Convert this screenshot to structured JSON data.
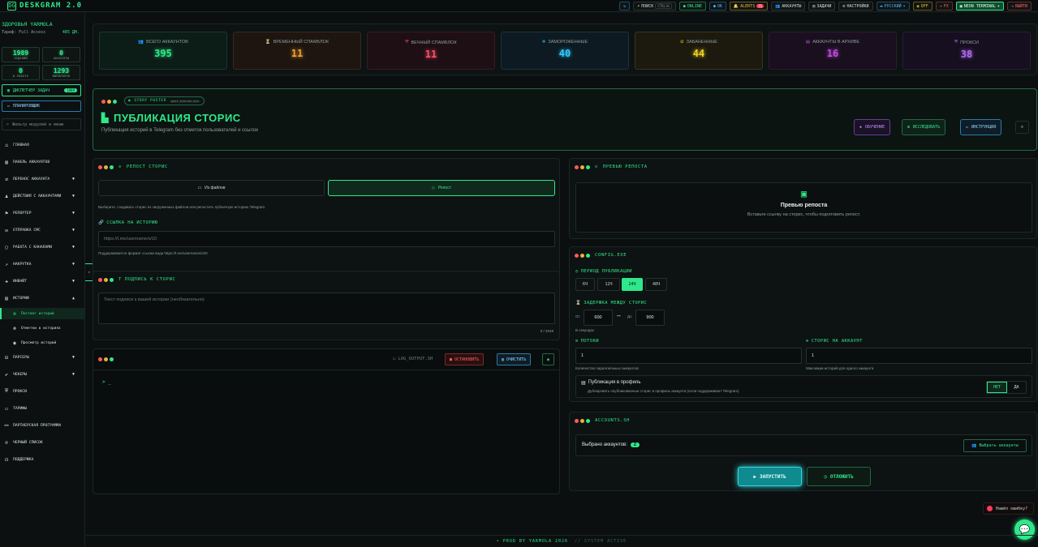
{
  "app": {
    "title": "DESKGRAM 2.0",
    "logo": "DG"
  },
  "topbar": {
    "refresh_icon": "refresh-icon",
    "search_label": "ПОИСК",
    "search_kbd": "CTRL+K",
    "online": "ONLINE",
    "ok": "OK",
    "alerts": "ALERTS",
    "alerts_count": "71",
    "accounts": "АККАУНТЫ",
    "tasks": "ЗАДАЧИ",
    "settings": "НАСТРОЙКИ",
    "language": "РУССКИЙ",
    "off": "OFF",
    "fx": "FX",
    "theme": "NEON TERMINAL",
    "logout": "ВЫЙТИ"
  },
  "sidebar": {
    "user_name": "ЗДОРОВЬЯ YARMOLA",
    "tariff": "Тариф: Full Access",
    "balance": "485 ДН.",
    "stats": [
      {
        "value": "1989",
        "label": "ЗАДАНИЙ"
      },
      {
        "value": "0",
        "label": "АККАУНТЫ"
      },
      {
        "value": "0",
        "label": "В РАБОТЕ"
      },
      {
        "value": "1293",
        "label": "ВЫПОЛНЕНО"
      }
    ],
    "dispatcher": "ДИСПЕТЧЕР ЗАДАЧ",
    "dispatcher_badge": "1989",
    "planner": "ПЛАНИРОВЩИК",
    "filter_placeholder": "Фильтр модулей и меню",
    "nav": [
      {
        "label": "ГЛАВНАЯ",
        "icon": "home-icon"
      },
      {
        "label": "ПАНЕЛЬ АККАУНТОВ",
        "icon": "users-icon"
      },
      {
        "label": "ПЕРЕНОС АККАУНТА",
        "icon": "transfer-icon",
        "chev": "▼"
      },
      {
        "label": "ДЕЙСТВИЯ С АККАУНТАМИ",
        "icon": "user-action-icon",
        "chev": "▼"
      },
      {
        "label": "РЕПОРТЕР",
        "icon": "flag-icon",
        "chev": "▼"
      },
      {
        "label": "ОТПРАВКА СМС",
        "icon": "message-icon",
        "chev": "▼"
      },
      {
        "label": "РАБОТА С КАНАЛАМИ",
        "icon": "channel-icon",
        "chev": "▼"
      },
      {
        "label": "НАКРУТКА",
        "icon": "chart-icon",
        "chev": "▼"
      },
      {
        "label": "ИНВАЙТ",
        "icon": "invite-icon",
        "chev": "▼"
      },
      {
        "label": "ИСТОРИИ",
        "icon": "stories-icon",
        "chev": "▲"
      }
    ],
    "sub_nav": [
      {
        "label": "Постинг историй",
        "icon": "plus-circle-icon"
      },
      {
        "label": "Отметки в историях",
        "icon": "tag-icon"
      },
      {
        "label": "Просмотр историй",
        "icon": "eye-icon"
      }
    ],
    "nav2": [
      {
        "label": "ПАРСЕРЫ",
        "icon": "parser-icon",
        "chev": "▼"
      },
      {
        "label": "ЧЕКЕРЫ",
        "icon": "check-icon",
        "chev": "▼"
      },
      {
        "label": "ПРОКСИ",
        "icon": "shield-icon"
      },
      {
        "label": "ТАРИФЫ",
        "icon": "card-icon"
      },
      {
        "label": "ПАРТНЕРСКАЯ ПРОГРАММА",
        "icon": "partner-icon"
      },
      {
        "label": "ЧЕРНЫЙ СПИСОК",
        "icon": "block-icon"
      },
      {
        "label": "ПОДДЕРЖКА",
        "icon": "support-icon"
      }
    ]
  },
  "stats_cards": [
    {
      "title": "ВСЕГО АККАУНТОВ",
      "value": "395",
      "color": "#2ee88a",
      "icon": "users-icon"
    },
    {
      "title": "ВРЕМЕННЫЙ СПАМБЛОК",
      "value": "11",
      "color": "#f0a030",
      "icon": "hourglass-icon"
    },
    {
      "title": "ВЕЧНЫЙ СПАМБЛОК",
      "value": "11",
      "color": "#ff4f6a",
      "icon": "shield-icon"
    },
    {
      "title": "ЗАМОРОЖЕННЫЕ",
      "value": "40",
      "color": "#33c8ff",
      "icon": "snowflake-icon"
    },
    {
      "title": "ЗАБАНЕННЫЕ",
      "value": "44",
      "color": "#f0d020",
      "icon": "ban-icon"
    },
    {
      "title": "АККАУНТЫ В АРХИВЕ",
      "value": "16",
      "color": "#c04ae0",
      "icon": "archive-icon"
    },
    {
      "title": "ПРОКСИ",
      "value": "38",
      "color": "#b06cf0",
      "icon": "proxy-icon"
    }
  ],
  "hero": {
    "tag": "STORY POSTER",
    "file": "post_stories.exe",
    "title": "ПУБЛИКАЦИЯ СТОРИС",
    "description": "Публикация историй в Telegram без отметок пользователей и ссылок",
    "btn_learn": "ОБУЧЕНИЕ",
    "btn_research": "ИССЛЕДОВАТЬ",
    "btn_instruction": "ИНСТРУКЦИЯ"
  },
  "repost": {
    "title": "РЕПОСТ СТОРИС",
    "from_files": "Из файлов",
    "repost": "Репост",
    "hint": "Выберите, создавать сторис из загруженных файлов или репостить публичную историю Telegram.",
    "link_label": "ССЫЛКА НА ИСТОРИЮ",
    "link_placeholder": "https://t.me/username/s/10",
    "link_note": "Поддерживается формат ссылки вида https://t.me/username/s/20"
  },
  "caption": {
    "title": "Т ПОДПИСЬ К СТОРИС",
    "placeholder": "Текст подписи к вашей истории (необязательно)",
    "counter": "0 / 2048"
  },
  "log": {
    "file": "LOG_OUTPUT.SH",
    "stop": "ОСТАНОВИТЬ",
    "clear": "ОЧИСТИТЬ",
    "prompt": "> _"
  },
  "preview": {
    "title": "ПРЕВЬЮ РЕПОСТА",
    "heading": "Превью репоста",
    "text": "Вставьте ссылку на сторис, чтобы подготовить репост."
  },
  "config": {
    "title": "CONFIG.EXE",
    "period_label": "ПЕРИОД ПУБЛИКАЦИИ",
    "periods": [
      "6Ч",
      "12Ч",
      "24Ч",
      "48Ч"
    ],
    "period_selected": "24Ч",
    "delay_label": "ЗАДЕРЖКА МЕЖДУ СТОРИС",
    "from": "От",
    "from_value": "600",
    "to": "До",
    "to_value": "900",
    "seconds": "В секундах",
    "threads_label": "ПОТОКИ",
    "threads_value": "1",
    "threads_note": "Количество параллельных аккаунтов",
    "per_account_label": "СТОРИС НА АККАУНТ",
    "per_account_value": "1",
    "per_account_note": "Максимум историй для одного аккаунта",
    "profile_title": "Публикация в профиль",
    "profile_desc": "Дублировать опубликованные сторис в профиль аккаунта (если поддерживает Telegram)",
    "no": "НЕТ",
    "yes": "ДА"
  },
  "accounts": {
    "title": "ACCOUNTS.SH",
    "selected_label": "Выбрано аккаунтов:",
    "selected_count": "2",
    "select_btn": "Выбрать аккаунты",
    "start": "ЗАПУСТИТЬ",
    "postpone": "ОТЛОЖИТЬ"
  },
  "toast": "Нашёл ошибку?",
  "footer": {
    "left": "• PROD BY YARMOLA 2026",
    "right": "// SYSTEM ACTIVE"
  }
}
